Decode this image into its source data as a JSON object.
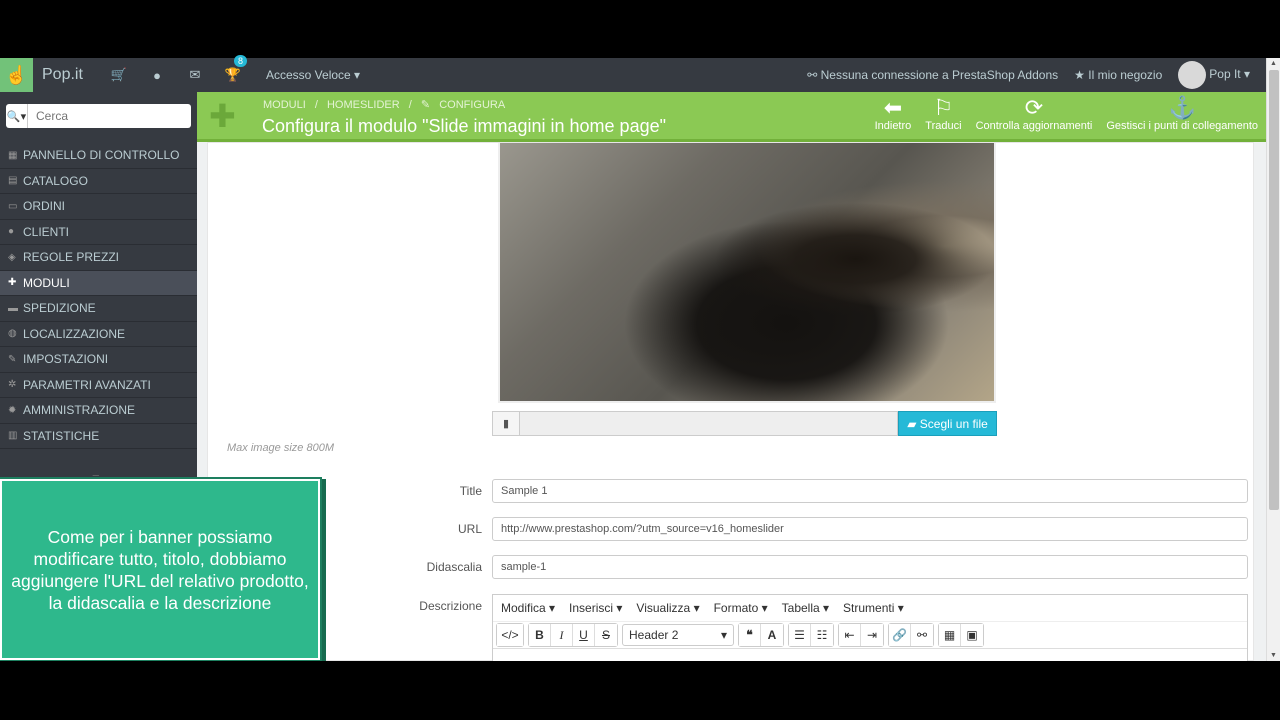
{
  "header": {
    "brand": "Pop.it",
    "notifications_count": "8",
    "quick_access": "Accesso Veloce",
    "addons_status": "Nessuna connessione a PrestaShop Addons",
    "my_shop": "Il mio negozio",
    "user": "Pop It"
  },
  "sidebar": {
    "search_placeholder": "Cerca",
    "items": [
      {
        "label": "PANNELLO DI CONTROLLO",
        "icon": "dashboard-icon"
      },
      {
        "label": "CATALOGO",
        "icon": "book-icon"
      },
      {
        "label": "ORDINI",
        "icon": "credit-card-icon"
      },
      {
        "label": "CLIENTI",
        "icon": "users-icon"
      },
      {
        "label": "REGOLE PREZZI",
        "icon": "tags-icon"
      },
      {
        "label": "MODULI",
        "icon": "puzzle-icon",
        "active": true
      },
      {
        "label": "SPEDIZIONE",
        "icon": "truck-icon"
      },
      {
        "label": "LOCALIZZAZIONE",
        "icon": "globe-icon"
      },
      {
        "label": "IMPOSTAZIONI",
        "icon": "wrench-icon"
      },
      {
        "label": "PARAMETRI AVANZATI",
        "icon": "cogs-icon"
      },
      {
        "label": "AMMINISTRAZIONE",
        "icon": "cog-icon"
      },
      {
        "label": "STATISTICHE",
        "icon": "bar-chart-icon"
      }
    ]
  },
  "toolbar": {
    "breadcrumb": [
      "MODULI",
      "/",
      "HOMESLIDER",
      "/",
      "CONFIGURA"
    ],
    "title": "Configura il modulo \"Slide immagini in home page\"",
    "buttons": [
      {
        "label": "Indietro",
        "icon": "arrow-left-circle-icon"
      },
      {
        "label": "Traduci",
        "icon": "flag-icon"
      },
      {
        "label": "Controlla aggiornamenti",
        "icon": "refresh-icon"
      },
      {
        "label": "Gestisci i punti di collegamento",
        "icon": "anchor-icon"
      }
    ]
  },
  "form": {
    "choose_file": "Scegli un file",
    "max_size_hint": "Max image size 800M",
    "title_label": "Title",
    "title_value": "Sample 1",
    "url_label": "URL",
    "url_value": "http://www.prestashop.com/?utm_source=v16_homeslider",
    "caption_label": "Didascalia",
    "caption_value": "sample-1",
    "description_label": "Descrizione",
    "editor_menu": [
      "Modifica",
      "Inserisci",
      "Visualizza",
      "Formato",
      "Tabella",
      "Strumenti"
    ],
    "editor_format": "Header 2"
  },
  "callout": {
    "text": "Come per i banner possiamo modificare tutto, titolo, dobbiamo aggiungere l'URL del relativo prodotto, la didascalia e la descrizione"
  },
  "colors": {
    "toolbar_green": "#8bc954",
    "accent_blue": "#25b9d7",
    "callout_green": "#2eb88c",
    "sidebar_dark": "#363a41"
  }
}
